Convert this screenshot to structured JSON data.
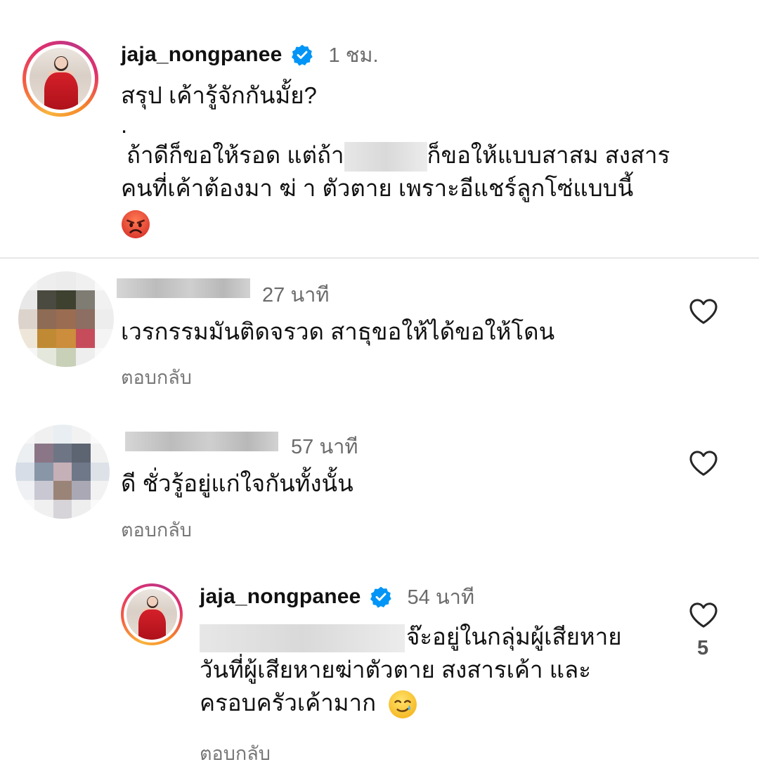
{
  "post": {
    "username": "jaja_nongpanee",
    "time": "1 ชม.",
    "caption_line1": "สรุป เค้ารู้จักกันมั้ย?",
    "caption_line2": ".",
    "caption_line3_part1": "ถ้าดีก็ขอให้รอด แต่ถ้า",
    "caption_line3_part2": "ก็ขอให้แบบสาสม สงสาร",
    "caption_line4": "คนที่เค้าต้องมา ฆ่ า ตัวตาย เพราะอีแชร์ลูกโซ่แบบนี้",
    "emoji": "angry-face-icon"
  },
  "comments": [
    {
      "time": "27 นาที",
      "text": "เวรกรรมมันติดจรวด สาธุขอให้ได้ขอให้โดน",
      "reply_label": "ตอบกลับ"
    },
    {
      "time": "57 นาที",
      "text": "ดี ชั่วรู้อยู่แก่ใจกันทั้งนั้น",
      "reply_label": "ตอบกลับ"
    }
  ],
  "reply": {
    "username": "jaja_nongpanee",
    "time": "54 นาที",
    "text_line1": "จ๊ะอยู่ในกลุ่มผู้เสียหาย",
    "text_line2": "วันที่ผู้เสียหายฆ่าตัวตาย สงสารเค้า และ",
    "text_line3": "ครอบครัวเค้ามาก",
    "emoji": "smiling-face-with-tear-icon",
    "reply_label": "ตอบกลับ",
    "likes": "5"
  },
  "colors": {
    "verified": "#0095f6",
    "secondary_text": "#6b6b6b",
    "divider": "#e6e6e6"
  }
}
